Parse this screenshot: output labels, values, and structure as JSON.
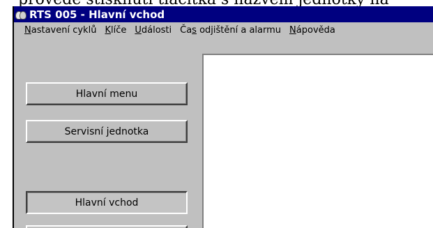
{
  "document": {
    "caption_fragment": "provede stisknutí tlačítka s názvem jednotky na"
  },
  "window": {
    "title": "RTS 005 - Hlavní vchod",
    "icon": "app-icon"
  },
  "menu": {
    "items": [
      {
        "pre": "",
        "ul": "N",
        "post": "astavení cyklů"
      },
      {
        "pre": "",
        "ul": "K",
        "post": "líče"
      },
      {
        "pre": "",
        "ul": "U",
        "post": "dálosti"
      },
      {
        "pre": "Ča",
        "ul": "s",
        "post": " odjištění a alarmu"
      },
      {
        "pre": "",
        "ul": "N",
        "post": "ápověda"
      }
    ]
  },
  "buttons": {
    "main_menu": "Hlavní menu",
    "service_unit": "Servisní jednotka",
    "main_entrance": "Hlavní vchod"
  },
  "colors": {
    "titlebar": "#000080",
    "face": "#c0c0c0",
    "content": "#ffffff"
  }
}
